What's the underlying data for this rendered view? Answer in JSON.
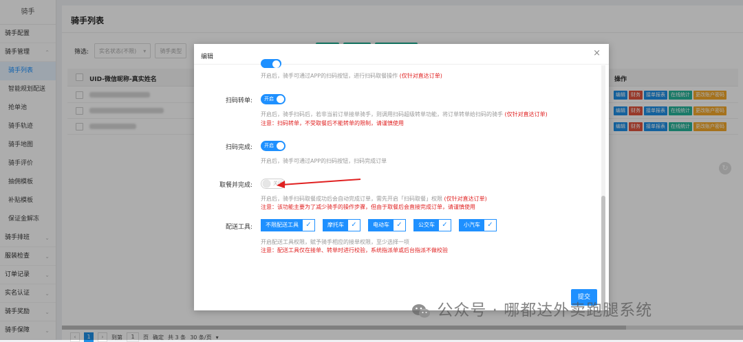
{
  "sidebar": {
    "logo": "骑手",
    "items": [
      {
        "label": "骑手配置",
        "chev": ""
      },
      {
        "label": "骑手管理",
        "chev": "^"
      },
      {
        "label": "骑手列表",
        "chev": ""
      },
      {
        "label": "智能规划配送",
        "chev": ""
      },
      {
        "label": "抢单池",
        "chev": ""
      },
      {
        "label": "骑手轨迹",
        "chev": ""
      },
      {
        "label": "骑手地图",
        "chev": ""
      },
      {
        "label": "骑手评价",
        "chev": ""
      },
      {
        "label": "抽佣模板",
        "chev": ""
      },
      {
        "label": "补贴模板",
        "chev": ""
      },
      {
        "label": "保证金解冻",
        "chev": ""
      },
      {
        "label": "骑手排班",
        "chev": "v"
      },
      {
        "label": "服装检查",
        "chev": "v"
      },
      {
        "label": "订单记录",
        "chev": "v"
      },
      {
        "label": "实名认证",
        "chev": "v"
      },
      {
        "label": "骑手奖励",
        "chev": "v"
      },
      {
        "label": "骑手保障",
        "chev": "v"
      }
    ]
  },
  "main": {
    "title": "骑手列表",
    "filter_label": "筛选:",
    "select1": "实名状态(不限)",
    "select2": "骑手类型",
    "col_uid": "UID-微信昵称-真实姓名",
    "col_ops": "操作",
    "ops": [
      "编辑",
      "财务",
      "接单报表",
      "在线统计",
      "更改账户密码"
    ],
    "pager": {
      "page": "1",
      "goto_label": "到第",
      "goto_value": "1",
      "page_unit": "页",
      "confirm": "确定",
      "total": "共 3 条",
      "per_page": "30 条/页"
    }
  },
  "modal": {
    "title": "编辑",
    "close": "×",
    "hint_top": "开启后，骑手可通过APP的扫码按钮，进行扫码取餐操作",
    "hint_top_red": "(仅针对直达订单)",
    "scan_transfer": {
      "label": "扫码转单:",
      "switch": "开启",
      "hint": "开启后，骑手扫码后，若非当前订单接单骑手，则调用扫码超级转单功能，将订单转单给扫码的骑手",
      "hint_red": "(仅针对直达订单)",
      "warn": "注意：扫码转单，不受取餐后不能转单的限制，请谨慎使用"
    },
    "scan_complete": {
      "label": "扫码完成:",
      "switch": "开启",
      "hint": "开启后，骑手可通过APP的扫码按钮，扫码完成订单"
    },
    "pickup_complete": {
      "label": "取餐并完成:",
      "switch": "关闭",
      "hint": "开启后，骑手扫码取餐成功后会自动完成订单，需先开启「扫码取餐」权限",
      "hint_red": "(仅针对直达订单)",
      "warn": "注意：该功能主要为了减少骑手的操作步骤，但由于取餐后会直接完成订单，请谨慎使用"
    },
    "delivery_tools": {
      "label": "配送工具:",
      "tools": [
        "不限配送工具",
        "摩托车",
        "电动车",
        "公交车",
        "小汽车"
      ],
      "hint": "开启配送工具权限，赋予骑手相应的接单权限，至少选择一项",
      "warn": "注意：配送工具仅在接单、转单时进行校验，系统指派单或后台指派不做校验"
    },
    "submit": "提交"
  },
  "watermark": "公众号 · 哪都达外卖跑腿系统",
  "colors": {
    "primary": "#1e90ff",
    "danger": "#e02020",
    "teal": "#1ab394",
    "orange": "#f4a92b"
  }
}
